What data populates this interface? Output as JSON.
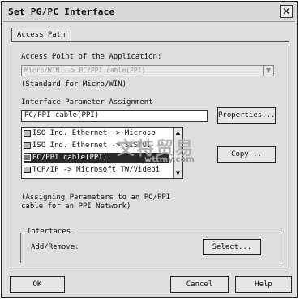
{
  "window": {
    "title": "Set PG/PC Interface"
  },
  "tabs": [
    {
      "label": "Access Path"
    }
  ],
  "access_point": {
    "label": "Access Point of the Application:",
    "value": "Micro/WIN      --> PC/PPI cable(PPI)",
    "note": "(Standard for Micro/WIN)"
  },
  "interface_param": {
    "label": "Interface Parameter Assignment",
    "value": "PC/PPI cable(PPI)",
    "properties_button": "Properties...",
    "copy_button": "Copy..."
  },
  "interface_list": [
    {
      "label": "ISO Ind. Ethernet -> Microso",
      "selected": false
    },
    {
      "label": "ISO Ind. Ethernet -> SISTOI",
      "selected": false
    },
    {
      "label": "PC/PPI cable(PPI)",
      "selected": true
    },
    {
      "label": "TCP/IP -> Microsoft TW/Videoi",
      "selected": false
    }
  ],
  "description": "(Assigning Parameters to an PC/PPI cable for an PPI Network)",
  "interfaces_group": {
    "title": "Interfaces",
    "add_remove_label": "Add/Remove:",
    "select_button": "Select..."
  },
  "footer": {
    "ok": "OK",
    "cancel": "Cancel",
    "help": "Help"
  },
  "watermark": {
    "text": "文特贸易",
    "url": "wttmy.com"
  }
}
